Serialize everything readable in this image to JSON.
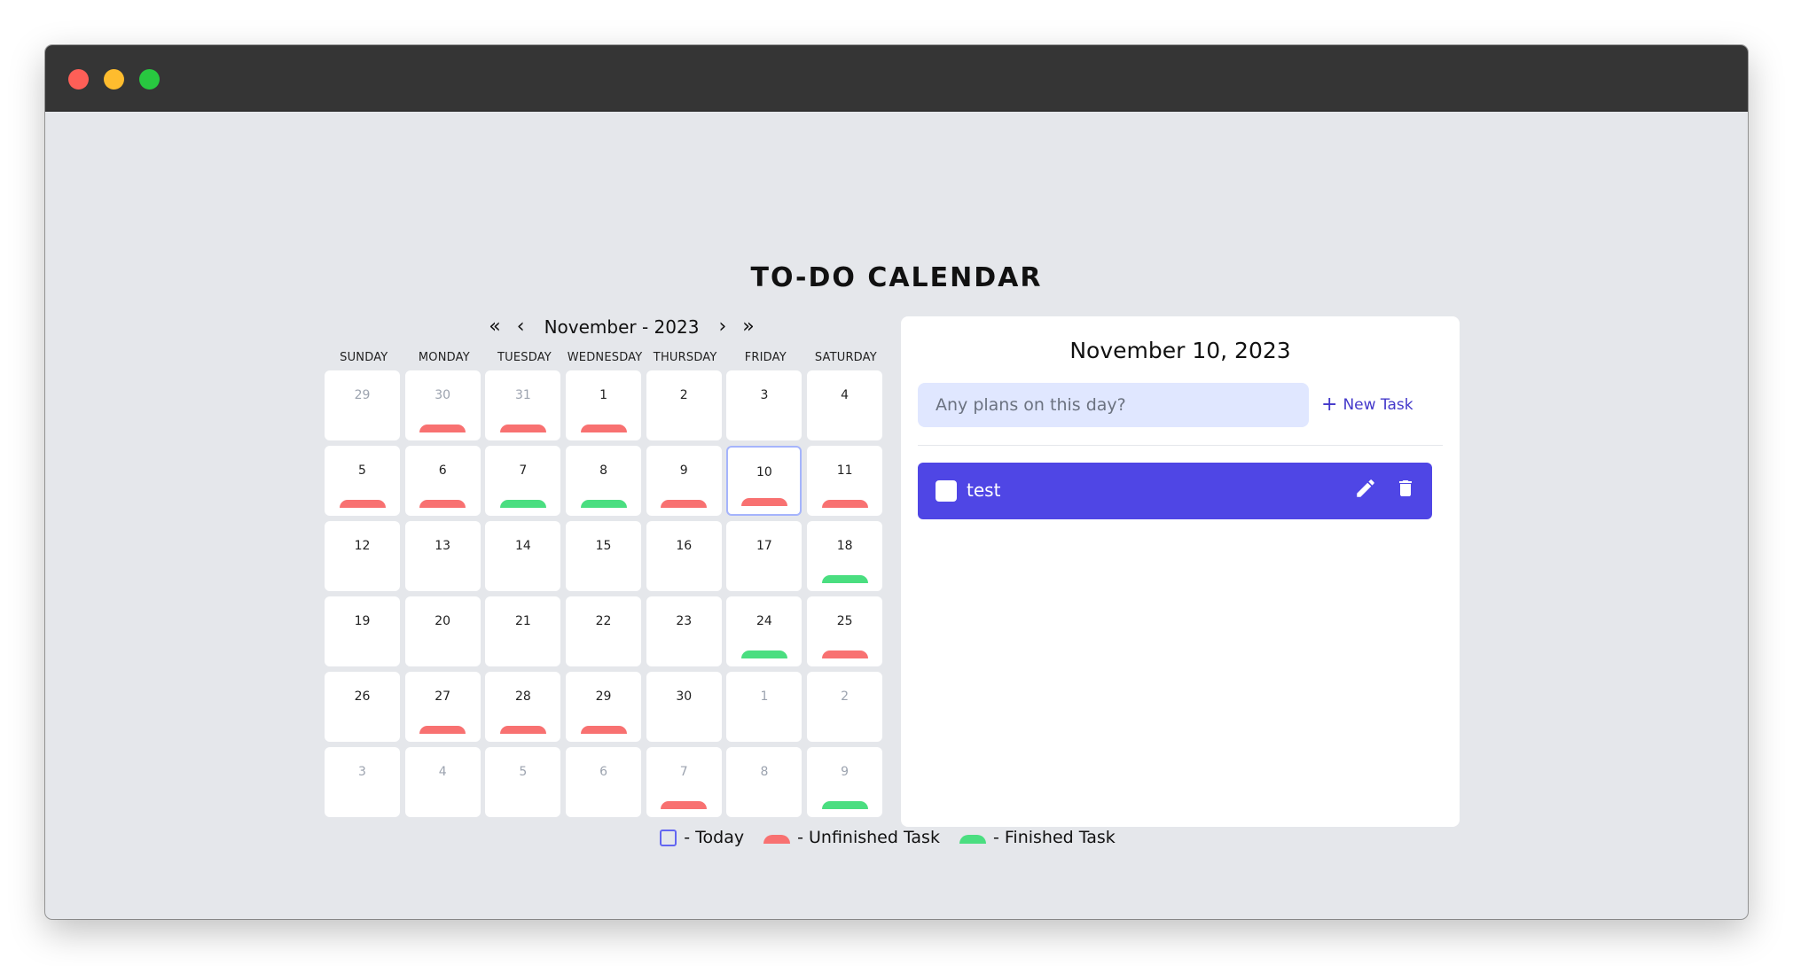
{
  "app": {
    "title": "TO-DO CALENDAR"
  },
  "calendar": {
    "nav": {
      "prev_year": "«",
      "prev_month": "‹",
      "month_label": "November - 2023",
      "next_month": "›",
      "next_year": "»"
    },
    "weekdays": [
      "SUNDAY",
      "MONDAY",
      "TUESDAY",
      "WEDNESDAY",
      "THURSDAY",
      "FRIDAY",
      "SATURDAY"
    ],
    "days": [
      {
        "n": "29",
        "other": true,
        "marker": null
      },
      {
        "n": "30",
        "other": true,
        "marker": "unfinished"
      },
      {
        "n": "31",
        "other": true,
        "marker": "unfinished"
      },
      {
        "n": "1",
        "other": false,
        "marker": "unfinished"
      },
      {
        "n": "2",
        "other": false,
        "marker": null
      },
      {
        "n": "3",
        "other": false,
        "marker": null
      },
      {
        "n": "4",
        "other": false,
        "marker": null
      },
      {
        "n": "5",
        "other": false,
        "marker": "unfinished"
      },
      {
        "n": "6",
        "other": false,
        "marker": "unfinished"
      },
      {
        "n": "7",
        "other": false,
        "marker": "finished"
      },
      {
        "n": "8",
        "other": false,
        "marker": "finished"
      },
      {
        "n": "9",
        "other": false,
        "marker": "unfinished"
      },
      {
        "n": "10",
        "other": false,
        "marker": "unfinished",
        "today": true
      },
      {
        "n": "11",
        "other": false,
        "marker": "unfinished"
      },
      {
        "n": "12",
        "other": false,
        "marker": null
      },
      {
        "n": "13",
        "other": false,
        "marker": null
      },
      {
        "n": "14",
        "other": false,
        "marker": null
      },
      {
        "n": "15",
        "other": false,
        "marker": null
      },
      {
        "n": "16",
        "other": false,
        "marker": null
      },
      {
        "n": "17",
        "other": false,
        "marker": null
      },
      {
        "n": "18",
        "other": false,
        "marker": "finished"
      },
      {
        "n": "19",
        "other": false,
        "marker": null
      },
      {
        "n": "20",
        "other": false,
        "marker": null
      },
      {
        "n": "21",
        "other": false,
        "marker": null
      },
      {
        "n": "22",
        "other": false,
        "marker": null
      },
      {
        "n": "23",
        "other": false,
        "marker": null
      },
      {
        "n": "24",
        "other": false,
        "marker": "finished"
      },
      {
        "n": "25",
        "other": false,
        "marker": "unfinished"
      },
      {
        "n": "26",
        "other": false,
        "marker": null
      },
      {
        "n": "27",
        "other": false,
        "marker": "unfinished"
      },
      {
        "n": "28",
        "other": false,
        "marker": "unfinished"
      },
      {
        "n": "29",
        "other": false,
        "marker": "unfinished"
      },
      {
        "n": "30",
        "other": false,
        "marker": null
      },
      {
        "n": "1",
        "other": true,
        "marker": null
      },
      {
        "n": "2",
        "other": true,
        "marker": null
      },
      {
        "n": "3",
        "other": true,
        "marker": null
      },
      {
        "n": "4",
        "other": true,
        "marker": null
      },
      {
        "n": "5",
        "other": true,
        "marker": null
      },
      {
        "n": "6",
        "other": true,
        "marker": null
      },
      {
        "n": "7",
        "other": true,
        "marker": "unfinished"
      },
      {
        "n": "8",
        "other": true,
        "marker": null
      },
      {
        "n": "9",
        "other": true,
        "marker": "finished"
      }
    ]
  },
  "panel": {
    "date": "November 10, 2023",
    "input_placeholder": "Any plans on this day?",
    "input_value": "",
    "new_task_icon": "plus-icon",
    "new_task_label": "New Task",
    "tasks": [
      {
        "text": "test",
        "done": false,
        "edit_icon": "pencil-icon",
        "delete_icon": "trash-icon"
      }
    ]
  },
  "legend": {
    "today": "- Today",
    "unfinished": "- Unfinished Task",
    "finished": "- Finished Task"
  },
  "colors": {
    "accent": "#4f46e5",
    "unfinished": "#f87171",
    "finished": "#4ade80",
    "today_border": "#a5b4fc",
    "input_bg": "#e0e7ff"
  }
}
